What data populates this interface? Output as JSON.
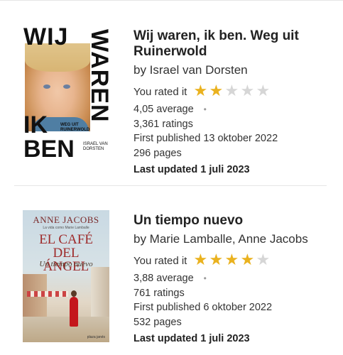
{
  "books": [
    {
      "title": "Wij waren, ik ben. Weg uit Ruinerwold",
      "author": "by Israel van Dorsten",
      "rated_label": "You rated it",
      "user_rating": 2,
      "average": "4,05 average",
      "ratings": "3,361 ratings",
      "first_published": "First published 13 oktober 2022",
      "pages": "296 pages",
      "last_updated": "Last updated 1 juli 2023",
      "cover": {
        "line1": "WIJ",
        "line2": "WAREN",
        "line3": "IK",
        "line4": "BEN",
        "subtitle": "WEG UIT RUINERWOLD",
        "author": "ISRAEL VAN DORSTEN"
      }
    },
    {
      "title": "Un tiempo nuevo",
      "author": "by Marie Lamballe, Anne Jacobs",
      "rated_label": "You rated it",
      "user_rating": 4,
      "average": "3,88 average",
      "ratings": "761 ratings",
      "first_published": "First published 6 oktober 2022",
      "pages": "532 pages",
      "last_updated": "Last updated 1 juli 2023",
      "cover": {
        "author": "ANNE JACOBS",
        "tagline": "La vida como Marie Lamballe",
        "title": "EL CAFÉ DEL ÁNGEL",
        "subtitle": "Un tiempo nuevo",
        "publisher": "plaza janés"
      }
    }
  ],
  "colors": {
    "star_on": "#eab21f",
    "star_off": "#d6d6d6"
  }
}
